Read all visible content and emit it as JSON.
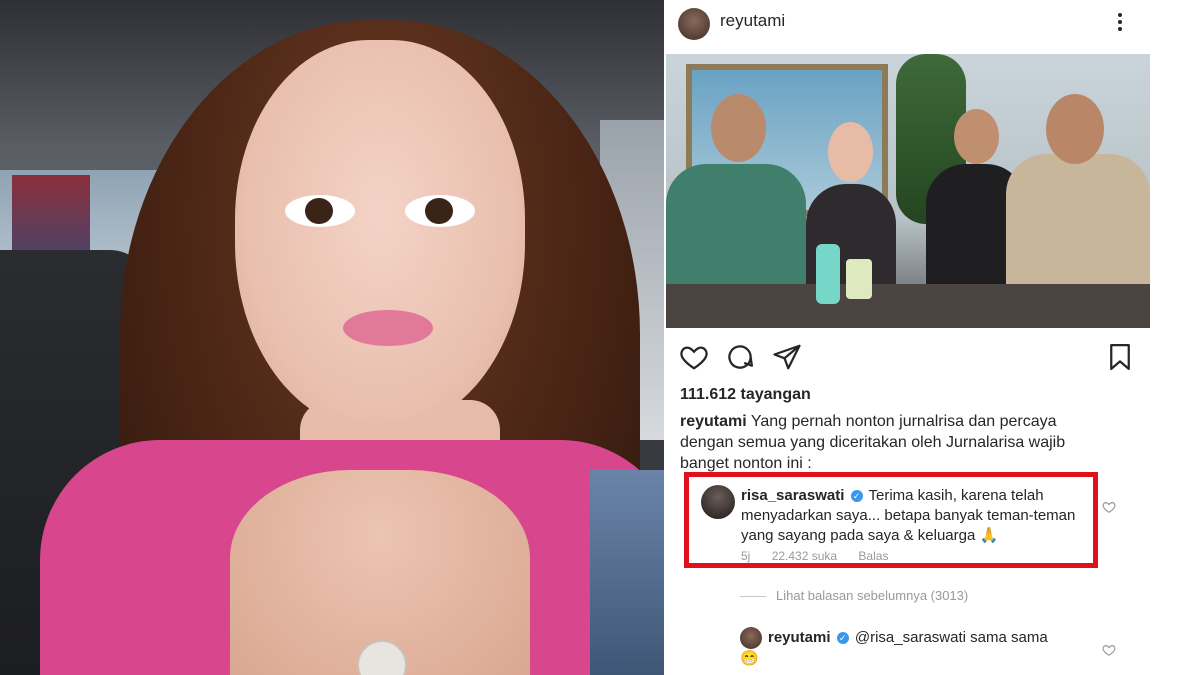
{
  "post": {
    "username": "reyutami",
    "views": "111.612 tayangan",
    "caption_user": "reyutami",
    "caption_text": "Yang pernah nonton jurnalrisa dan percaya dengan semua yang diceritakan oleh Jurnalarisa wajib banget nonton ini :"
  },
  "icons": {
    "like": "heart-icon",
    "comment": "comment-icon",
    "share": "share-icon",
    "save": "bookmark-icon",
    "more": "more-icon",
    "verified": "verified-icon"
  },
  "highlighted_comment": {
    "username": "risa_saraswati",
    "text": "Terima kasih, karena telah menyadarkan saya... betapa banyak teman-teman yang sayang pada saya & keluarga 🙏",
    "time": "5j",
    "likes": "22.432 suka",
    "reply_label": "Balas"
  },
  "view_replies": "Lihat balasan sebelumnya (3013)",
  "reply": {
    "username": "reyutami",
    "text": "@risa_saraswati sama sama",
    "emoji": "😁"
  },
  "colors": {
    "highlight_border": "#e0101d",
    "verified": "#3897f0",
    "text": "#262626",
    "muted": "#999999"
  }
}
